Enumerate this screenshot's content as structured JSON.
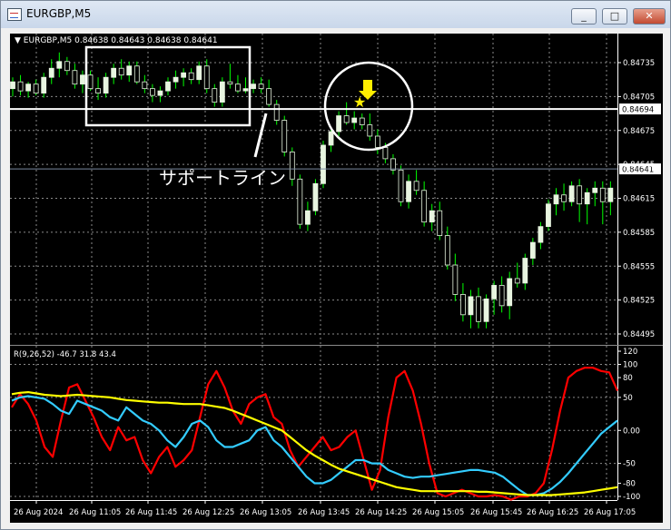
{
  "window": {
    "title": "EURGBP,M5",
    "buttons": {
      "minimize": "_",
      "maximize": "□",
      "close": "✕"
    }
  },
  "main_header": "EURGBP,M5  0.84638 0.84643 0.84638 0.84641",
  "indicator_header": "R(9,26,52) -46.7 31.8 43.4",
  "annotations": {
    "support_line_label": "サポートライン",
    "support_line_price": "0.84694",
    "current_price": "0.84641"
  },
  "colors": {
    "background": "#000000",
    "grid": "#8a8a8a",
    "bull_candle": "#e8f5e0",
    "wick": "#00ff00",
    "rsi_red": "#ff0000",
    "rsi_cyan": "#33ccff",
    "rsi_yellow": "#ffff00",
    "highlight": "#ffffff",
    "marker": "#ffee00"
  },
  "chart_data": [
    {
      "type": "candlestick",
      "title": "EURGBP,M5",
      "x_tick_labels": [
        "26 Aug 2024",
        "26 Aug 11:05",
        "26 Aug 11:45",
        "26 Aug 12:25",
        "26 Aug 13:05",
        "26 Aug 13:45",
        "26 Aug 14:25",
        "26 Aug 15:05",
        "26 Aug 15:45",
        "26 Aug 16:25",
        "26 Aug 17:05"
      ],
      "y_tick_labels": [
        "0.84735",
        "0.84705",
        "0.84675",
        "0.84645",
        "0.84615",
        "0.84585",
        "0.84555",
        "0.84525",
        "0.84495"
      ],
      "ylim": [
        0.8449,
        0.8476
      ],
      "grid": true,
      "horizontal_lines": [
        0.84694,
        0.84641
      ],
      "candles": [
        [
          0.84712,
          0.84722,
          0.84705,
          0.84718
        ],
        [
          0.84718,
          0.84724,
          0.84706,
          0.8471
        ],
        [
          0.8471,
          0.84718,
          0.84704,
          0.84716
        ],
        [
          0.84716,
          0.8472,
          0.84706,
          0.84708
        ],
        [
          0.84708,
          0.84726,
          0.84704,
          0.84722
        ],
        [
          0.84722,
          0.84738,
          0.84716,
          0.8473
        ],
        [
          0.8473,
          0.84744,
          0.84722,
          0.84736
        ],
        [
          0.84736,
          0.8474,
          0.84724,
          0.84728
        ],
        [
          0.84728,
          0.84734,
          0.84712,
          0.84716
        ],
        [
          0.84716,
          0.84728,
          0.84708,
          0.84724
        ],
        [
          0.84724,
          0.84728,
          0.8471,
          0.84712
        ],
        [
          0.84712,
          0.84722,
          0.84702,
          0.84708
        ],
        [
          0.84708,
          0.84726,
          0.84704,
          0.84722
        ],
        [
          0.84722,
          0.84734,
          0.84716,
          0.8473
        ],
        [
          0.8473,
          0.84738,
          0.8472,
          0.84724
        ],
        [
          0.84724,
          0.84736,
          0.84718,
          0.84732
        ],
        [
          0.84732,
          0.84736,
          0.84716,
          0.84718
        ],
        [
          0.84718,
          0.84724,
          0.84708,
          0.84712
        ],
        [
          0.84712,
          0.84716,
          0.847,
          0.84706
        ],
        [
          0.84706,
          0.84714,
          0.847,
          0.8471
        ],
        [
          0.8471,
          0.84722,
          0.84706,
          0.84718
        ],
        [
          0.84718,
          0.84728,
          0.84712,
          0.84722
        ],
        [
          0.84722,
          0.8473,
          0.84714,
          0.84726
        ],
        [
          0.84726,
          0.8473,
          0.84716,
          0.8472
        ],
        [
          0.8472,
          0.84736,
          0.84716,
          0.84732
        ],
        [
          0.84732,
          0.84738,
          0.84708,
          0.84712
        ],
        [
          0.84712,
          0.84716,
          0.84696,
          0.847
        ],
        [
          0.847,
          0.84722,
          0.84696,
          0.84718
        ],
        [
          0.84718,
          0.84734,
          0.84712,
          0.84716
        ],
        [
          0.84716,
          0.84724,
          0.84708,
          0.8471
        ],
        [
          0.8471,
          0.84722,
          0.84708,
          0.84712
        ],
        [
          0.84712,
          0.8472,
          0.84708,
          0.84716
        ],
        [
          0.84716,
          0.84722,
          0.84708,
          0.84712
        ],
        [
          0.84712,
          0.8472,
          0.84696,
          0.84698
        ],
        [
          0.84698,
          0.84702,
          0.8468,
          0.84684
        ],
        [
          0.84684,
          0.84688,
          0.84652,
          0.84656
        ],
        [
          0.84656,
          0.8466,
          0.84626,
          0.84632
        ],
        [
          0.84632,
          0.84636,
          0.84588,
          0.84592
        ],
        [
          0.84592,
          0.84612,
          0.84586,
          0.84604
        ],
        [
          0.84604,
          0.84632,
          0.846,
          0.84628
        ],
        [
          0.84628,
          0.84666,
          0.84624,
          0.84662
        ],
        [
          0.84662,
          0.84678,
          0.84656,
          0.84674
        ],
        [
          0.84674,
          0.84692,
          0.8467,
          0.84688
        ],
        [
          0.84688,
          0.847,
          0.8468,
          0.84682
        ],
        [
          0.84682,
          0.84692,
          0.84676,
          0.84686
        ],
        [
          0.84686,
          0.8469,
          0.84676,
          0.8468
        ],
        [
          0.8468,
          0.8469,
          0.84666,
          0.8467
        ],
        [
          0.8467,
          0.84676,
          0.84654,
          0.8466
        ],
        [
          0.8466,
          0.84664,
          0.84646,
          0.8465
        ],
        [
          0.8465,
          0.84654,
          0.84636,
          0.8464
        ],
        [
          0.8464,
          0.84644,
          0.84608,
          0.84612
        ],
        [
          0.84612,
          0.84636,
          0.84606,
          0.8463
        ],
        [
          0.8463,
          0.8464,
          0.84618,
          0.84622
        ],
        [
          0.84622,
          0.8463,
          0.8459,
          0.84594
        ],
        [
          0.84594,
          0.8461,
          0.84586,
          0.84604
        ],
        [
          0.84604,
          0.84612,
          0.84578,
          0.84582
        ],
        [
          0.84582,
          0.8459,
          0.84552,
          0.84556
        ],
        [
          0.84556,
          0.84566,
          0.84524,
          0.8453
        ],
        [
          0.8453,
          0.8454,
          0.84506,
          0.84512
        ],
        [
          0.84512,
          0.84534,
          0.845,
          0.84528
        ],
        [
          0.84528,
          0.84536,
          0.845,
          0.84506
        ],
        [
          0.84506,
          0.8453,
          0.845,
          0.84526
        ],
        [
          0.84526,
          0.84542,
          0.84512,
          0.84538
        ],
        [
          0.84538,
          0.84546,
          0.84514,
          0.8452
        ],
        [
          0.8452,
          0.8455,
          0.84508,
          0.84544
        ],
        [
          0.84544,
          0.84558,
          0.84536,
          0.8454
        ],
        [
          0.8454,
          0.84566,
          0.84534,
          0.84562
        ],
        [
          0.84562,
          0.8458,
          0.84556,
          0.84576
        ],
        [
          0.84576,
          0.84594,
          0.8457,
          0.8459
        ],
        [
          0.8459,
          0.84614,
          0.84586,
          0.8461
        ],
        [
          0.8461,
          0.84624,
          0.846,
          0.84618
        ],
        [
          0.84618,
          0.84628,
          0.84604,
          0.84612
        ],
        [
          0.84612,
          0.8463,
          0.84608,
          0.84626
        ],
        [
          0.84626,
          0.84632,
          0.84594,
          0.8461
        ],
        [
          0.8461,
          0.84624,
          0.84592,
          0.8462
        ],
        [
          0.8462,
          0.8463,
          0.84608,
          0.84624
        ],
        [
          0.84624,
          0.8463,
          0.84592,
          0.84612
        ],
        [
          0.84612,
          0.8463,
          0.846,
          0.84624
        ]
      ]
    },
    {
      "type": "line",
      "title": "R(9,26,52) -46.7 31.8 43.4",
      "y_tick_labels": [
        "120",
        "100",
        "80",
        "50",
        "0.00",
        "-50",
        "-80",
        "-100"
      ],
      "ylim": [
        -105,
        120
      ],
      "series": [
        {
          "color": "#ff0000",
          "values": [
            35,
            55,
            40,
            15,
            -25,
            -40,
            15,
            65,
            70,
            45,
            20,
            -10,
            -30,
            5,
            -15,
            -10,
            -45,
            -65,
            -40,
            -25,
            -55,
            -45,
            -30,
            20,
            70,
            90,
            65,
            30,
            10,
            40,
            50,
            55,
            20,
            10,
            -30,
            -55,
            -40,
            -25,
            -10,
            -30,
            -25,
            -10,
            0,
            -45,
            -90,
            -60,
            20,
            80,
            90,
            60,
            10,
            -50,
            -95,
            -100,
            -95,
            -90,
            -95,
            -100,
            -100,
            -98,
            -100,
            -105,
            -100,
            -100,
            -95,
            -80,
            -30,
            30,
            80,
            90,
            95,
            95,
            90,
            88,
            60
          ]
        },
        {
          "color": "#33ccff",
          "values": [
            45,
            50,
            52,
            50,
            48,
            40,
            30,
            25,
            45,
            40,
            35,
            30,
            20,
            15,
            35,
            25,
            15,
            10,
            0,
            -15,
            -25,
            -10,
            10,
            15,
            5,
            -15,
            -25,
            -25,
            -20,
            -15,
            0,
            5,
            -15,
            -25,
            -40,
            -55,
            -70,
            -80,
            -80,
            -75,
            -65,
            -55,
            -45,
            -45,
            -50,
            -50,
            -60,
            -65,
            -70,
            -72,
            -70,
            -70,
            -68,
            -66,
            -64,
            -62,
            -60,
            -60,
            -62,
            -64,
            -70,
            -80,
            -90,
            -98,
            -98,
            -95,
            -88,
            -78,
            -65,
            -50,
            -35,
            -20,
            -5,
            5,
            15
          ]
        },
        {
          "color": "#ffff00",
          "values": [
            55,
            57,
            58,
            56,
            54,
            53,
            52,
            53,
            54,
            53,
            52,
            51,
            50,
            48,
            46,
            45,
            44,
            43,
            42,
            42,
            41,
            40,
            40,
            40,
            38,
            36,
            34,
            30,
            25,
            20,
            15,
            10,
            5,
            0,
            -10,
            -20,
            -30,
            -38,
            -45,
            -52,
            -58,
            -62,
            -66,
            -70,
            -74,
            -78,
            -82,
            -86,
            -88,
            -90,
            -92,
            -92,
            -92,
            -92,
            -92,
            -92,
            -92,
            -93,
            -93,
            -94,
            -95,
            -96,
            -97,
            -98,
            -98,
            -98,
            -98,
            -97,
            -96,
            -95,
            -94,
            -92,
            -90,
            -88,
            -86
          ]
        }
      ]
    }
  ]
}
